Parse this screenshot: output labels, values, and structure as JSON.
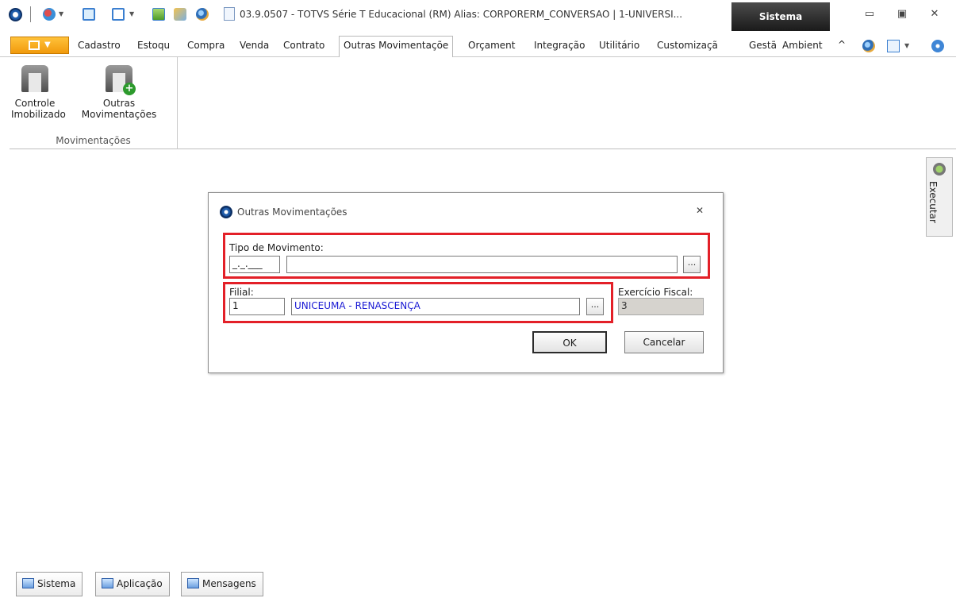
{
  "titlebar": {
    "title": "03.9.0507 - TOTVS Série T Educacional (RM) Alias: CORPORERM_CONVERSAO | 1-UNIVERSI...",
    "sistema_tab": "Sistema",
    "icons": [
      "totvs-logo-icon",
      "quick-access-icon",
      "window-icon",
      "toolbar-icon",
      "tools-icon",
      "globe-icon",
      "document-icon"
    ]
  },
  "ribbon": {
    "tabs": [
      "Cadastro",
      "Estoqu",
      "Compra",
      "Venda",
      "Contrato",
      "Outras Movimentaçõe",
      "Orçament",
      "Integração",
      "Utilitário",
      "Customizaçã",
      "Gestã",
      "Ambient"
    ],
    "active_tab": "Outras Movimentaçõe",
    "group": {
      "label": "Movimentações",
      "buttons": [
        {
          "line1": "Controle",
          "line2": "Imobilizado"
        },
        {
          "line1": "Outras",
          "line2": "Movimentações"
        }
      ]
    }
  },
  "side_panel": {
    "executar_label": "Executar"
  },
  "dialog": {
    "title": "Outras Movimentações",
    "tipo_movimento": {
      "label": "Tipo de Movimento:",
      "code_value": "_._.___",
      "description_value": "",
      "browse_label": "..."
    },
    "filial": {
      "label": "Filial:",
      "code_value": "1",
      "name_value": "UNICEUMA - RENASCENÇA",
      "browse_label": "..."
    },
    "exercicio_fiscal": {
      "label": "Exercício Fiscal:",
      "value": "3"
    },
    "ok_label": "OK",
    "cancel_label": "Cancelar"
  },
  "statusbar": {
    "tabs": [
      "Sistema",
      "Aplicação",
      "Mensagens"
    ]
  },
  "colors": {
    "accent_orange": "#f19a0c",
    "highlight_red": "#e32028",
    "link_blue": "#1a1ad4"
  }
}
